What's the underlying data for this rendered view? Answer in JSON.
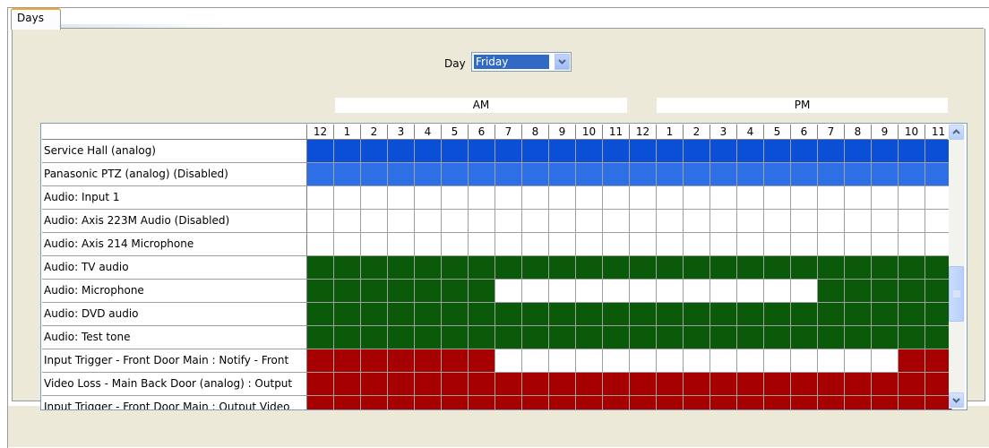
{
  "tabs": [
    {
      "label": "Days"
    }
  ],
  "day_selector": {
    "label": "Day",
    "value": "Friday"
  },
  "period_labels": {
    "am": "AM",
    "pm": "PM"
  },
  "hours": [
    "12",
    "1",
    "2",
    "3",
    "4",
    "5",
    "6",
    "7",
    "8",
    "9",
    "10",
    "11",
    "12",
    "1",
    "2",
    "3",
    "4",
    "5",
    "6",
    "7",
    "8",
    "9",
    "10",
    "11"
  ],
  "colors": {
    "blue_dark": "#0a4fd6",
    "blue": "#2f6fe6",
    "green": "#0a5a0a",
    "red": "#a60000",
    "white": "#ffffff"
  },
  "rows": [
    {
      "label": "Service Hall (analog)",
      "cells": "BBBBBBBBBBBBBBBBBBBBBBBB"
    },
    {
      "label": "Panasonic PTZ (analog) (Disabled)",
      "cells": "LLLLLLLLLLLLLLLLLLLLLLLL"
    },
    {
      "label": "Audio: Input 1",
      "cells": "WWWWWWWWWWWWWWWWWWWWWWWW"
    },
    {
      "label": "Audio: Axis 223M Audio (Disabled)",
      "cells": "WWWWWWWWWWWWWWWWWWWWWWWW"
    },
    {
      "label": "Audio: Axis 214 Microphone",
      "cells": "WWWWWWWWWWWWWWWWWWWWWWWW"
    },
    {
      "label": "Audio: TV audio",
      "cells": "GGGGGGGGGGGGGGGGGGGGGGGG"
    },
    {
      "label": "Audio: Microphone",
      "cells": "GGGGGGGWWWWWWWWWWWWGGGGG"
    },
    {
      "label": "Audio: DVD audio",
      "cells": "GGGGGGGGGGGGGGGGGGGGGGGG"
    },
    {
      "label": "Audio: Test tone",
      "cells": "GGGGGGGGGGGGGGGGGGGGGGGG"
    },
    {
      "label": "Input Trigger - Front Door Main : Notify - Front",
      "cells": "RRRRRRRWWWWWWWWWWWWWWWRR"
    },
    {
      "label": "Video Loss - Main Back Door (analog) : Output",
      "cells": "RRRRRRRRRRRRRRRRRRRRRRRR"
    },
    {
      "label": "Input Trigger - Front Door Main : Output Video",
      "cells": "RRRRRRRRRRRRRRRRRRRRRRRR"
    }
  ]
}
